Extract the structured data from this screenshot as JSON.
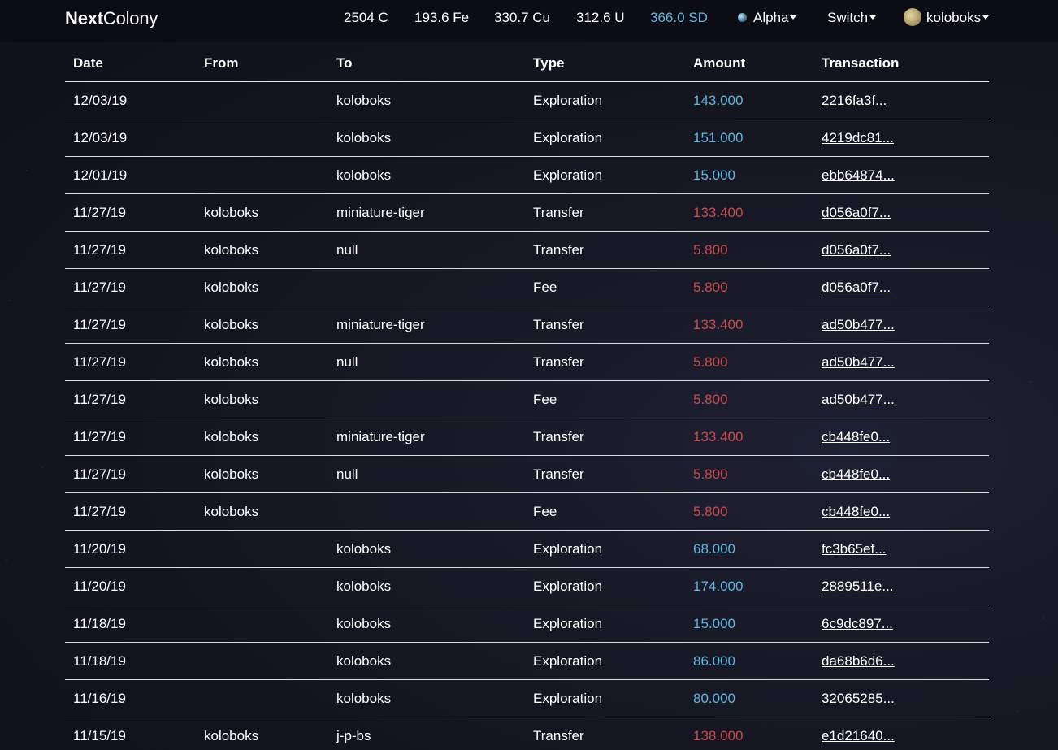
{
  "nav": {
    "brand_bold": "Next",
    "brand_rest": "Colony",
    "resources": [
      {
        "text": "2504 C"
      },
      {
        "text": "193.6 Fe"
      },
      {
        "text": "330.7 Cu"
      },
      {
        "text": "312.6 U"
      },
      {
        "text": "366.0 SD"
      }
    ],
    "planet_label": "Alpha",
    "planet_icon": "planet-icon",
    "switch_label": "Switch",
    "user_label": "koloboks",
    "user_icon": "avatar"
  },
  "colors": {
    "positive_amount": "#5eb6de",
    "negative_amount": "#c84a4a",
    "sd_highlight": "#5eb6de"
  },
  "table": {
    "headers": {
      "date": "Date",
      "from": "From",
      "to": "To",
      "type": "Type",
      "amount": "Amount",
      "transaction": "Transaction"
    },
    "rows": [
      {
        "date": "12/03/19",
        "from": "",
        "to": "koloboks",
        "type": "Exploration",
        "amount": "143.000",
        "sign": "positive",
        "tx": "2216fa3f..."
      },
      {
        "date": "12/03/19",
        "from": "",
        "to": "koloboks",
        "type": "Exploration",
        "amount": "151.000",
        "sign": "positive",
        "tx": "4219dc81..."
      },
      {
        "date": "12/01/19",
        "from": "",
        "to": "koloboks",
        "type": "Exploration",
        "amount": "15.000",
        "sign": "positive",
        "tx": "ebb64874..."
      },
      {
        "date": "11/27/19",
        "from": "koloboks",
        "to": "miniature-tiger",
        "type": "Transfer",
        "amount": "133.400",
        "sign": "negative",
        "tx": "d056a0f7..."
      },
      {
        "date": "11/27/19",
        "from": "koloboks",
        "to": "null",
        "type": "Transfer",
        "amount": "5.800",
        "sign": "negative",
        "tx": "d056a0f7..."
      },
      {
        "date": "11/27/19",
        "from": "koloboks",
        "to": "",
        "type": "Fee",
        "amount": "5.800",
        "sign": "negative",
        "tx": "d056a0f7..."
      },
      {
        "date": "11/27/19",
        "from": "koloboks",
        "to": "miniature-tiger",
        "type": "Transfer",
        "amount": "133.400",
        "sign": "negative",
        "tx": "ad50b477..."
      },
      {
        "date": "11/27/19",
        "from": "koloboks",
        "to": "null",
        "type": "Transfer",
        "amount": "5.800",
        "sign": "negative",
        "tx": "ad50b477..."
      },
      {
        "date": "11/27/19",
        "from": "koloboks",
        "to": "",
        "type": "Fee",
        "amount": "5.800",
        "sign": "negative",
        "tx": "ad50b477..."
      },
      {
        "date": "11/27/19",
        "from": "koloboks",
        "to": "miniature-tiger",
        "type": "Transfer",
        "amount": "133.400",
        "sign": "negative",
        "tx": "cb448fe0..."
      },
      {
        "date": "11/27/19",
        "from": "koloboks",
        "to": "null",
        "type": "Transfer",
        "amount": "5.800",
        "sign": "negative",
        "tx": "cb448fe0..."
      },
      {
        "date": "11/27/19",
        "from": "koloboks",
        "to": "",
        "type": "Fee",
        "amount": "5.800",
        "sign": "negative",
        "tx": "cb448fe0..."
      },
      {
        "date": "11/20/19",
        "from": "",
        "to": "koloboks",
        "type": "Exploration",
        "amount": "68.000",
        "sign": "positive",
        "tx": "fc3b65ef..."
      },
      {
        "date": "11/20/19",
        "from": "",
        "to": "koloboks",
        "type": "Exploration",
        "amount": "174.000",
        "sign": "positive",
        "tx": "2889511e..."
      },
      {
        "date": "11/18/19",
        "from": "",
        "to": "koloboks",
        "type": "Exploration",
        "amount": "15.000",
        "sign": "positive",
        "tx": "6c9dc897..."
      },
      {
        "date": "11/18/19",
        "from": "",
        "to": "koloboks",
        "type": "Exploration",
        "amount": "86.000",
        "sign": "positive",
        "tx": "da68b6d6..."
      },
      {
        "date": "11/16/19",
        "from": "",
        "to": "koloboks",
        "type": "Exploration",
        "amount": "80.000",
        "sign": "positive",
        "tx": "32065285..."
      },
      {
        "date": "11/15/19",
        "from": "koloboks",
        "to": "j-p-bs",
        "type": "Transfer",
        "amount": "138.000",
        "sign": "negative",
        "tx": "e1d21640..."
      }
    ]
  }
}
